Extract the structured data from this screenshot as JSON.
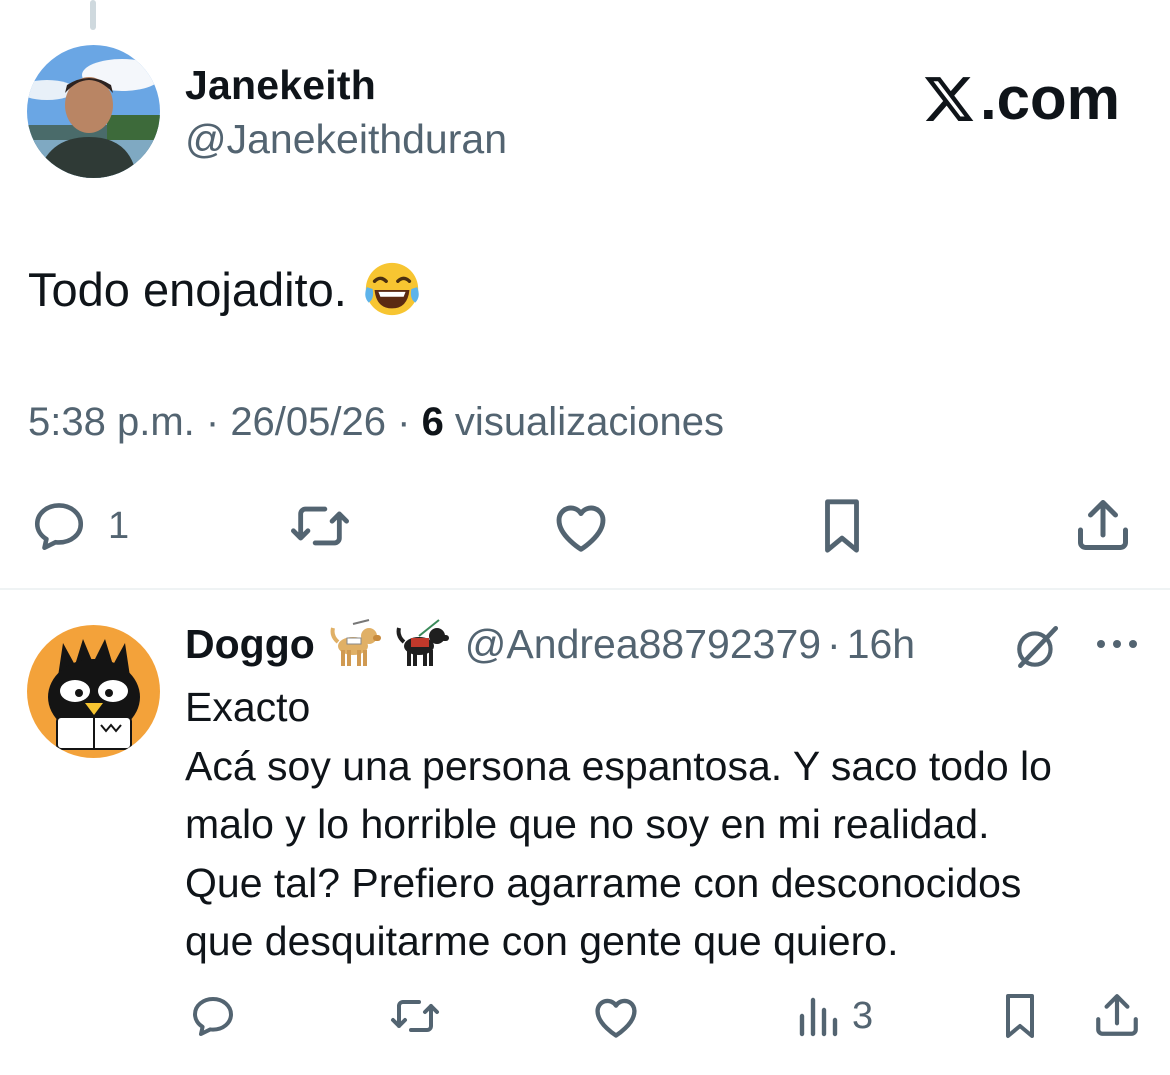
{
  "main_tweet": {
    "display_name": "Janekeith",
    "handle": "@Janekeithduran",
    "brand": ".com",
    "text": "Todo enojadito.",
    "emoji": "face-with-tears-of-joy",
    "time": "5:38 p.m.",
    "sep1": " · ",
    "date": "26/05/26",
    "sep2": " · ",
    "views_count": "6",
    "views_label": " visualizaciones",
    "actions": {
      "reply_count": "1"
    }
  },
  "reply": {
    "display_name": "Doggo",
    "handle": "@Andrea88792379",
    "dot": "·",
    "time": "16h",
    "lines": [
      "Exacto",
      "Acá soy una persona espantosa. Y saco todo lo",
      "malo y lo horrible que no soy en mi realidad.",
      "Que tal? Prefiero agarrame con desconocidos",
      "que desquitarme con gente que quiero."
    ],
    "actions": {
      "views_count": "3"
    }
  },
  "colors": {
    "text": "#0f1419",
    "secondary": "#536471",
    "divider": "#eff3f4"
  }
}
